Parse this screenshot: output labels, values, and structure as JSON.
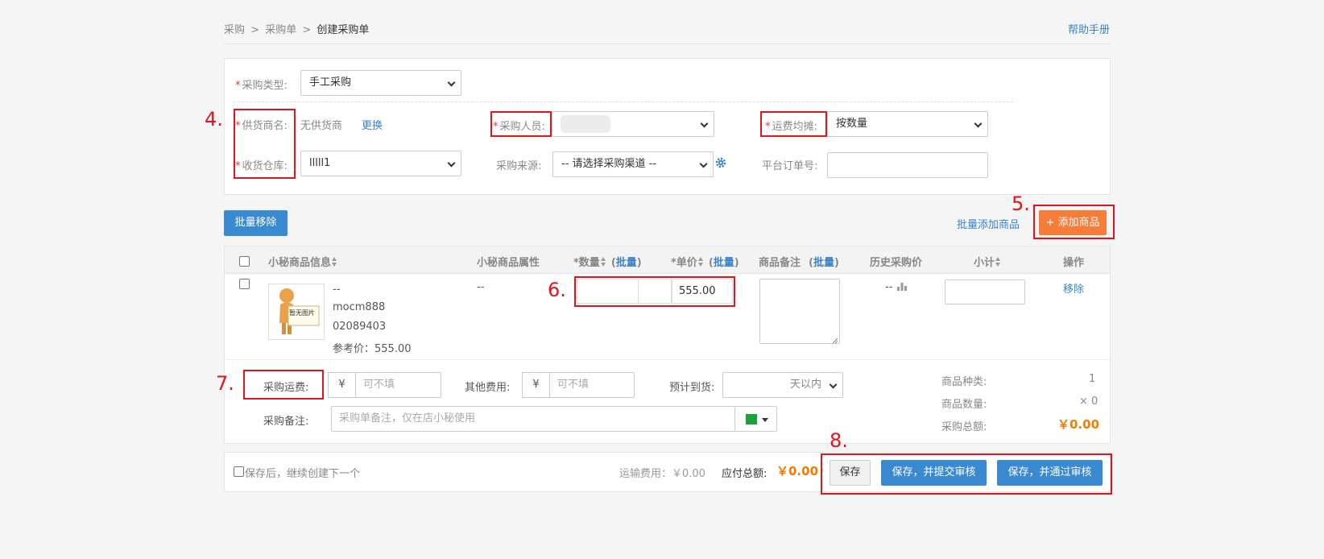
{
  "breadcrumb": {
    "items": [
      "采购",
      "采购单"
    ],
    "current": "创建采购单",
    "sep": ">"
  },
  "help_link": "帮助手册",
  "form": {
    "purchase_type": {
      "label": "采购类型:",
      "value": "手工采购"
    },
    "supplier": {
      "label": "供货商名:",
      "value": "无供货商",
      "action": "更换"
    },
    "buyer": {
      "label": "采购人员:",
      "value": ""
    },
    "freight_split": {
      "label": "运费均摊:",
      "value": "按数量"
    },
    "warehouse": {
      "label": "收货仓库:",
      "value": "lllll1"
    },
    "source": {
      "label": "采购来源:",
      "value": "-- 请选择采购渠道 --"
    },
    "platform_order": {
      "label": "平台订单号:",
      "value": ""
    },
    "required_mark": "*"
  },
  "toolbar": {
    "batch_remove": "批量移除",
    "batch_add": "批量添加商品",
    "add_product": "+ 添加商品"
  },
  "table": {
    "headers": {
      "info": "小秘商品信息",
      "attrs": "小秘商品属性",
      "qty": "*数量",
      "price": "*单价",
      "note": "商品备注",
      "batch": "批量",
      "history": "历史采购价",
      "subtotal": "小计",
      "action": "操作"
    },
    "rows": [
      {
        "image_label": "暂无图片",
        "name": "--",
        "sku": "mocm888",
        "code": "02089403",
        "ref_price": "参考价：555.00",
        "attrs": "--",
        "qty": "",
        "price": "555.00",
        "history": "--",
        "subtotal": "",
        "remove": "移除"
      }
    ]
  },
  "costs": {
    "freight_label": "采购运费:",
    "other_label": "其他费用:",
    "currency": "¥",
    "placeholder": "可不填",
    "eta_label": "预计到货:",
    "eta_value": "天以内",
    "remark_label": "采购备注:",
    "remark_placeholder": "采购单备注，仅在店小秘使用"
  },
  "summary": {
    "kinds_label": "商品种类:",
    "kinds_value": "1",
    "count_label": "商品数量:",
    "count_value": "× 0",
    "total_label": "采购总额:",
    "total_value": "￥0.00"
  },
  "footer": {
    "continue_label": "保存后，继续创建下一个",
    "shipping": "运输费用：￥0.00",
    "payable_label": "应付总额:",
    "payable_value": "￥0.00",
    "save": "保存",
    "save_submit": "保存，并提交审核",
    "save_approve": "保存，并通过审核"
  },
  "annotations": [
    "4.",
    "5.",
    "6.",
    "7.",
    "8."
  ],
  "colors": {
    "accent": "#3a8ad2",
    "orange": "#f57c39",
    "red_box": "#e2131b",
    "price": "#f57c00",
    "green": "#1aa23a"
  }
}
